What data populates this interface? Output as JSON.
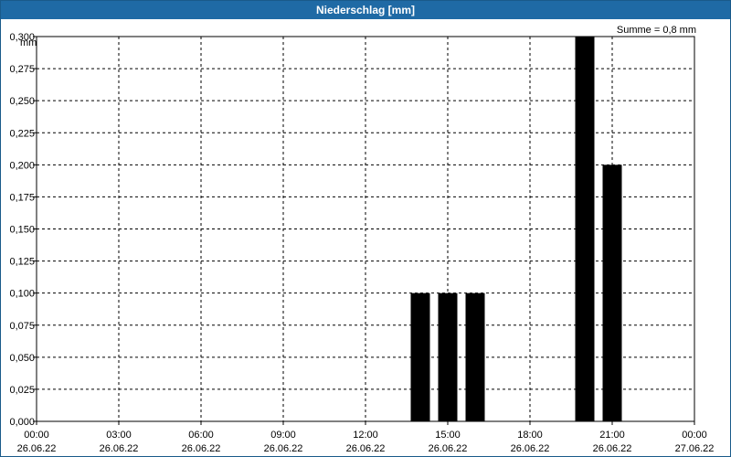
{
  "window": {
    "title": "Niederschlag [mm]"
  },
  "chart_data": {
    "type": "bar",
    "title": "Niederschlag [mm]",
    "ylabel": "mm",
    "summary": "Summe = 0,8 mm",
    "ylim": [
      0,
      0.3
    ],
    "xlim_hours": [
      0,
      24
    ],
    "y_ticks": [
      "0,000",
      "0,025",
      "0,050",
      "0,075",
      "0,100",
      "0,125",
      "0,150",
      "0,175",
      "0,200",
      "0,225",
      "0,250",
      "0,275",
      "0,300"
    ],
    "x_ticks": [
      {
        "time": "00:00",
        "date": "26.06.22"
      },
      {
        "time": "03:00",
        "date": "26.06.22"
      },
      {
        "time": "06:00",
        "date": "26.06.22"
      },
      {
        "time": "09:00",
        "date": "26.06.22"
      },
      {
        "time": "12:00",
        "date": "26.06.22"
      },
      {
        "time": "15:00",
        "date": "26.06.22"
      },
      {
        "time": "18:00",
        "date": "26.06.22"
      },
      {
        "time": "21:00",
        "date": "26.06.22"
      },
      {
        "time": "00:00",
        "date": "27.06.22"
      }
    ],
    "bars": [
      {
        "time": "14:00",
        "value": 0.1
      },
      {
        "time": "15:00",
        "value": 0.1
      },
      {
        "time": "16:00",
        "value": 0.1
      },
      {
        "time": "20:00",
        "value": 0.3
      },
      {
        "time": "21:00",
        "value": 0.2
      }
    ],
    "bar_color": "#000000",
    "grid": true
  }
}
